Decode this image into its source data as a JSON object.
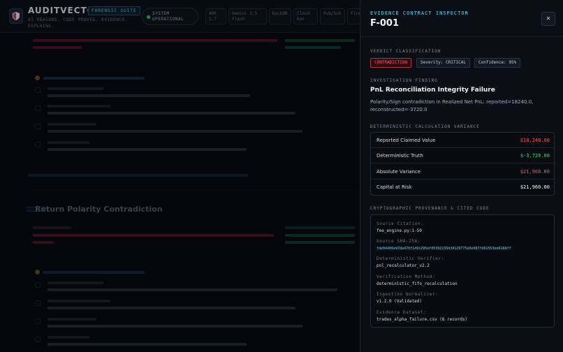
{
  "header": {
    "brand": "AUDITVECTOR",
    "suite_badge": "FORENSIC SUITE",
    "tagline": "AI REASONS. CODE PROVES. EVIDENCE EXPLAINS.",
    "status": "SYSTEM OPERATIONAL",
    "chips": [
      "ADK 2.7",
      "Gemini 3.5 Flash",
      "DuckDB",
      "Cloud Run",
      "Pub/Sub",
      "Fire"
    ]
  },
  "background": {
    "section_id": "",
    "section_title": "Return Polarity Contradiction"
  },
  "drawer": {
    "eyebrow": "EVIDENCE CONTRACT INSPECTOR",
    "title": "F-001",
    "close_icon": "close-icon",
    "verdict_label": "VERDICT CLASSIFICATION",
    "verdict": "CONTRADICTION",
    "severity": "Severity: CRITICAL",
    "confidence": "Confidence: 95%",
    "finding_label": "INVESTIGATION FINDING",
    "finding_title": "PnL Reconciliation Integrity Failure",
    "finding_desc": "Polarity/Sign contradiction in Realized Net PnL: reported=18240.0, reconstructed=-3720.0",
    "calc_label": "DETERMINISTIC CALCULATION VARIANCE",
    "calc_rows": [
      {
        "label": "Reported Claimed Value",
        "value": "$18,240.00",
        "color": "#ff4d5e"
      },
      {
        "label": "Deterministic Truth",
        "value": "$-3,720.00",
        "color": "#34d27f"
      },
      {
        "label": "Absolute Variance",
        "value": "$21,960.00",
        "color": "#ff4d5e"
      },
      {
        "label": "Capital at Risk",
        "value": "$21,960.00",
        "color": "#f2f5f8"
      }
    ],
    "prov_label": "CRYPTOGRAPHIC PROVENANCE & CITED CODE",
    "provenance": [
      {
        "key": "Source Citation:",
        "value": "fee_engine.py:1-50"
      },
      {
        "key": "Source SHA-256:",
        "value": "fde94406e97da470f149c295ef85392156b34129775a5e967fd01553ed4184ff"
      },
      {
        "key": "Deterministic Verifier:",
        "value": "pnl_recalculator_v2.2"
      },
      {
        "key": "Verification Method:",
        "value": "deterministic_fifo_recalculation"
      },
      {
        "key": "Ingestion Normalizer:",
        "value": "v1.2.0 (Validated)"
      },
      {
        "key": "Evidence Dataset:",
        "value": "trades_alpha_failure.csv (6 records)"
      }
    ]
  }
}
